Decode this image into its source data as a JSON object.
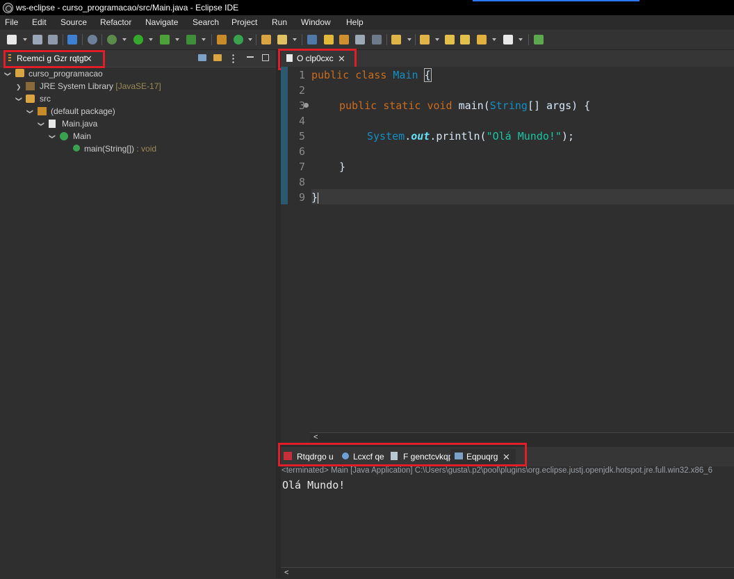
{
  "window": {
    "title": "ws-eclipse - curso_programacao/src/Main.java - Eclipse IDE"
  },
  "menu": [
    "File",
    "Edit",
    "Source",
    "Refactor",
    "Navigate",
    "Search",
    "Project",
    "Run",
    "Window",
    "Help"
  ],
  "left_panel": {
    "tab_label": "Rcemci g Gzr rqtgt",
    "tree": {
      "project": "curso_programacao",
      "jre_label": "JRE System Library",
      "jre_version": "[JavaSE-17]",
      "src": "src",
      "package": "(default package)",
      "file": "Main.java",
      "class": "Main",
      "method_name": "main(String[])",
      "method_return": " : void"
    }
  },
  "editor": {
    "tab_label": "O clp0cxc",
    "line_numbers": [
      "1",
      "2",
      "3",
      "4",
      "5",
      "6",
      "7",
      "8",
      "9"
    ],
    "code": {
      "l1_kw1": "public",
      "l1_kw2": "class",
      "l1_name": "Main",
      "l1_brace": "{",
      "l3_kw1": "public",
      "l3_kw2": "static",
      "l3_kw3": "void",
      "l3_method": "main(",
      "l3_type": "String",
      "l3_rest": "[] args) {",
      "l5_class": "System",
      "l5_dot": ".",
      "l5_field": "out",
      "l5_call": ".println(",
      "l5_string": "\"Olá Mundo!\"",
      "l5_end": ");",
      "l7_brace": "}",
      "l9_brace": "}"
    },
    "scroll_arrow": "<"
  },
  "bottom_panel": {
    "tabs": [
      {
        "label": "Rtqdrgo u",
        "icon": "problems-icon"
      },
      {
        "label": "Lcxcf qe",
        "icon": "javadoc-icon"
      },
      {
        "label": "F genctcvkqp",
        "icon": "declaration-icon"
      },
      {
        "label": "Eqpuqrg",
        "icon": "console-icon"
      }
    ],
    "console": {
      "status": "<terminated> Main [Java Application] C:\\Users\\gusta\\.p2\\pool\\plugins\\org.eclipse.justj.openjdk.hotspot.jre.full.win32.x86_6",
      "output": "Olá Mundo!",
      "scroll_arrow": "<"
    }
  },
  "close_glyph": "✕"
}
